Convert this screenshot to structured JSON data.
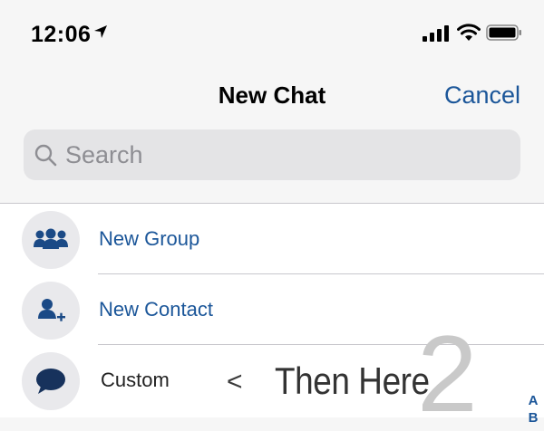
{
  "status_bar": {
    "time": "12:06",
    "icons": [
      "location-arrow-icon",
      "cellular-signal-icon",
      "wifi-icon",
      "battery-icon"
    ]
  },
  "nav": {
    "title": "New Chat",
    "cancel_label": "Cancel"
  },
  "search": {
    "placeholder": "Search",
    "value": ""
  },
  "list": {
    "items": [
      {
        "label": "New Group",
        "icon": "group-icon"
      },
      {
        "label": "New Contact",
        "icon": "add-contact-icon"
      },
      {
        "label": "Custom",
        "icon": "chat-bubble-icon"
      }
    ]
  },
  "annotation": {
    "arrow": "<",
    "text": "Then Here",
    "step": "2"
  },
  "index": [
    "A",
    "B"
  ],
  "colors": {
    "accent": "#1b5699",
    "background": "#f6f6f6",
    "search_bg": "#e4e4e6",
    "avatar_bg": "#e9e9ec",
    "separator": "#c8c7cc"
  }
}
